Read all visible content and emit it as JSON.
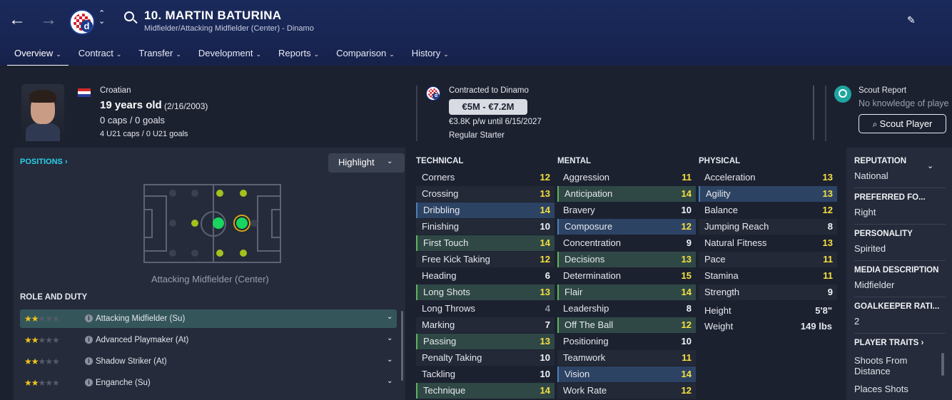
{
  "header": {
    "title": "10. MARTIN BATURINA",
    "subtitle": "Midfielder/Attacking Midfielder (Center) - Dinamo"
  },
  "tabs": [
    {
      "label": "Overview"
    },
    {
      "label": "Contract"
    },
    {
      "label": "Transfer"
    },
    {
      "label": "Development"
    },
    {
      "label": "Reports"
    },
    {
      "label": "Comparison"
    },
    {
      "label": "History"
    }
  ],
  "profile": {
    "nationality": "Croatian",
    "age": "19 years old",
    "dob": "(2/16/2003)",
    "caps": "0 caps / 0 goals",
    "u21": "4 U21 caps / 0 U21 goals"
  },
  "contract": {
    "club": "Contracted to Dinamo",
    "value": "€5M - €7.2M",
    "wage": "€3.8K p/w until 6/15/2027",
    "status": "Regular Starter"
  },
  "scout": {
    "title": "Scout Report",
    "knowledge": "No knowledge of playe",
    "button": "Scout Player"
  },
  "positions": {
    "link": "POSITIONS",
    "highlight": "Highlight",
    "caption": "Attacking Midfielder (Center)"
  },
  "roles": {
    "heading": "ROLE AND DUTY",
    "items": [
      {
        "name": "Attacking Midfielder (Su)",
        "stars": 2
      },
      {
        "name": "Advanced Playmaker (At)",
        "stars": 2
      },
      {
        "name": "Shadow Striker (At)",
        "stars": 2
      },
      {
        "name": "Enganche (Su)",
        "stars": 2
      }
    ]
  },
  "technical": {
    "heading": "TECHNICAL",
    "items": [
      {
        "name": "Corners",
        "value": "12"
      },
      {
        "name": "Crossing",
        "value": "13"
      },
      {
        "name": "Dribbling",
        "value": "14"
      },
      {
        "name": "Finishing",
        "value": "10"
      },
      {
        "name": "First Touch",
        "value": "14"
      },
      {
        "name": "Free Kick Taking",
        "value": "12"
      },
      {
        "name": "Heading",
        "value": "6"
      },
      {
        "name": "Long Shots",
        "value": "13"
      },
      {
        "name": "Long Throws",
        "value": "4"
      },
      {
        "name": "Marking",
        "value": "7"
      },
      {
        "name": "Passing",
        "value": "13"
      },
      {
        "name": "Penalty Taking",
        "value": "10"
      },
      {
        "name": "Tackling",
        "value": "10"
      },
      {
        "name": "Technique",
        "value": "14"
      }
    ]
  },
  "mental": {
    "heading": "MENTAL",
    "items": [
      {
        "name": "Aggression",
        "value": "11"
      },
      {
        "name": "Anticipation",
        "value": "14"
      },
      {
        "name": "Bravery",
        "value": "10"
      },
      {
        "name": "Composure",
        "value": "12"
      },
      {
        "name": "Concentration",
        "value": "9"
      },
      {
        "name": "Decisions",
        "value": "13"
      },
      {
        "name": "Determination",
        "value": "15"
      },
      {
        "name": "Flair",
        "value": "14"
      },
      {
        "name": "Leadership",
        "value": "8"
      },
      {
        "name": "Off The Ball",
        "value": "12"
      },
      {
        "name": "Positioning",
        "value": "10"
      },
      {
        "name": "Teamwork",
        "value": "11"
      },
      {
        "name": "Vision",
        "value": "14"
      },
      {
        "name": "Work Rate",
        "value": "12"
      }
    ]
  },
  "physical": {
    "heading": "PHYSICAL",
    "items": [
      {
        "name": "Acceleration",
        "value": "13"
      },
      {
        "name": "Agility",
        "value": "13"
      },
      {
        "name": "Balance",
        "value": "12"
      },
      {
        "name": "Jumping Reach",
        "value": "8"
      },
      {
        "name": "Natural Fitness",
        "value": "13"
      },
      {
        "name": "Pace",
        "value": "11"
      },
      {
        "name": "Stamina",
        "value": "11"
      },
      {
        "name": "Strength",
        "value": "9"
      }
    ],
    "height_label": "Height",
    "height": "5'8\"",
    "weight_label": "Weight",
    "weight": "149 lbs"
  },
  "sidebar": {
    "reputation_h": "REPUTATION",
    "reputation": "National",
    "foot_h": "PREFERRED FO...",
    "foot": "Right",
    "personality_h": "PERSONALITY",
    "personality": "Spirited",
    "media_h": "MEDIA DESCRIPTION",
    "media": "Midfielder",
    "gk_h": "GOALKEEPER RATI...",
    "gk": "2",
    "traits_h": "PLAYER TRAITS",
    "trait1a": "Shoots From",
    "trait1b": "Distance",
    "trait2": "Places Shots"
  }
}
